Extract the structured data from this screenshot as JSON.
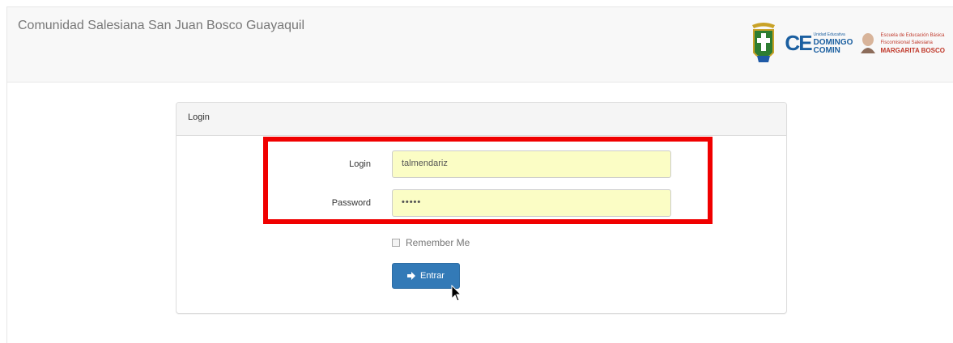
{
  "navbar": {
    "brand": "Comunidad Salesiana San Juan Bosco Guayaquil",
    "logos": {
      "comin": {
        "mark": "CE",
        "small": "Unidad Educativa",
        "line1": "DOMINGO",
        "line2": "COMIN"
      },
      "margarita": {
        "small1": "Escuela de Educación Básica",
        "small2": "Fiscomisional Salesiana",
        "big": "MARGARITA BOSCO"
      }
    }
  },
  "panel": {
    "heading": "Login",
    "login_label": "Login",
    "login_value": "talmendariz",
    "password_label": "Password",
    "password_value": "•••••",
    "remember_label": "Remember Me",
    "remember_checked": false,
    "submit_label": "Entrar",
    "submit_icon": "sign-in-icon"
  },
  "colors": {
    "accent": "#337ab7",
    "field_bg": "#fbfdc5",
    "highlight": "#f00000"
  }
}
